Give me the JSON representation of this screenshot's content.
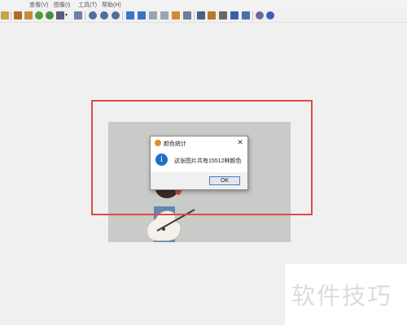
{
  "menubar": {
    "items": [
      "查看(V)",
      "图像(I)",
      "工具(T)",
      "帮助(H)"
    ]
  },
  "toolbar": {
    "buttons": [
      {
        "icon": "open-folder-icon",
        "color": "#c9a24a"
      },
      {
        "icon": "image-icon",
        "color": "#b4682a"
      },
      {
        "icon": "gallery-icon",
        "color": "#c98a3a"
      },
      {
        "icon": "refresh-icon",
        "color": "#4a9e3b"
      },
      {
        "icon": "rotate-icon",
        "color": "#3f8f3f"
      },
      {
        "icon": "view-mode-icon",
        "color": "#5a5a7a"
      },
      {
        "icon": "edit-icon",
        "color": "#6f7fa8"
      },
      {
        "icon": "zoom-in-icon",
        "color": "#4f6e9a"
      },
      {
        "icon": "zoom-out-icon",
        "color": "#4f6e9a"
      },
      {
        "icon": "zoom-fit-icon",
        "color": "#4f6e9a"
      },
      {
        "icon": "previous-icon",
        "color": "#3a73c8"
      },
      {
        "icon": "next-icon",
        "color": "#3a73c8"
      },
      {
        "icon": "first-page-icon",
        "color": "#9aa4b2"
      },
      {
        "icon": "last-page-icon",
        "color": "#9aa4b2"
      },
      {
        "icon": "slideshow-icon",
        "color": "#d28a2d"
      },
      {
        "icon": "screen-icon",
        "color": "#6b7d99"
      },
      {
        "icon": "crop-icon",
        "color": "#4a5f8a"
      },
      {
        "icon": "paint-icon",
        "color": "#b57a2a"
      },
      {
        "icon": "print-icon",
        "color": "#6a6a6a"
      },
      {
        "icon": "save-icon",
        "color": "#3b5fa8"
      },
      {
        "icon": "scan-icon",
        "color": "#4a6fa8"
      },
      {
        "icon": "settings-icon",
        "color": "#6a6aa0"
      },
      {
        "icon": "help-icon",
        "color": "#3a5fb8"
      }
    ]
  },
  "dialog": {
    "title": "颜色统计",
    "close_glyph": "✕",
    "info_glyph": "i",
    "message": "这张图片共有15512种颜色",
    "ok_label": "OK"
  },
  "watermark": {
    "text": "软件技巧"
  },
  "colors": {
    "annotation_border": "#e04a43",
    "photo_background": "#c9cbc8",
    "info_icon": "#1f6fc9",
    "ok_focus_border": "#3c7fd9"
  }
}
